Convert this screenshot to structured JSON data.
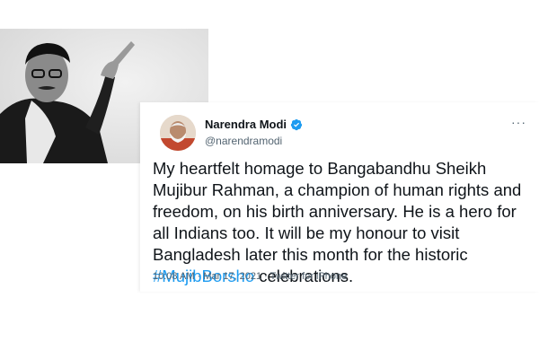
{
  "tweet": {
    "author_name": "Narendra Modi",
    "handle": "@narendramodi",
    "text_before_hashtag": "My heartfelt homage to Bangabandhu Sheikh Mujibur Rahman, a champion of human rights and freedom, on his birth anniversary. He is a hero for all Indians too. It will be my honour to visit Bangladesh later this month for the historic ",
    "hashtag": "#MujibBorsho",
    "text_after_hashtag": " celebrations.",
    "time": "10:08 AM",
    "separator": " · ",
    "date": "Mar 17, 2021",
    "source": "Twitter for iPhone"
  },
  "icons": {
    "verified": "verified-badge-icon",
    "more": "more-options-icon",
    "accent_color": "#1d9bf0"
  }
}
